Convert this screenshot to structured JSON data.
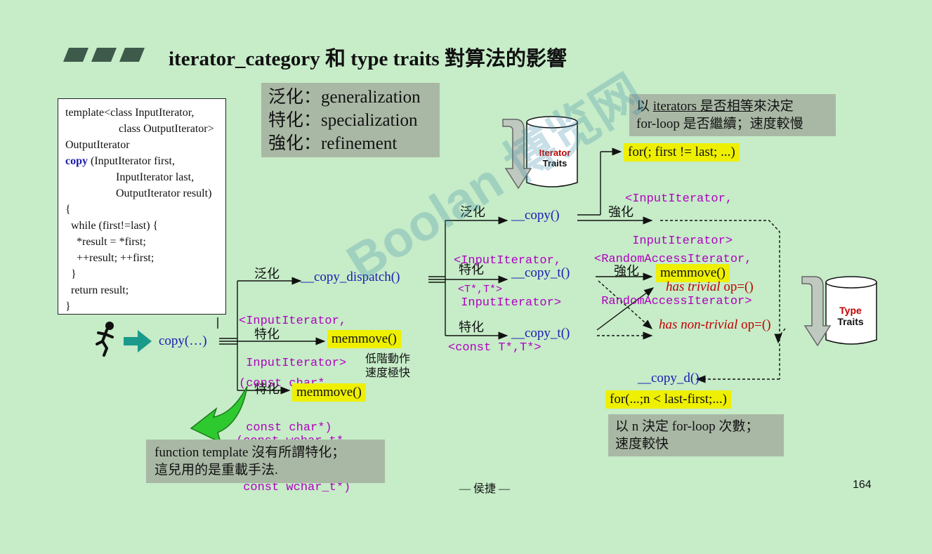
{
  "title": "iterator_category 和 type traits 對算法的影響",
  "legend": [
    "泛化：generalization",
    "特化：specialization",
    "強化：refinement"
  ],
  "code": [
    "template<class InputIterator,",
    "        class OutputIterator>",
    "OutputIterator",
    "copy",
    " (InputIterator first,",
    "        InputIterator last,",
    "        OutputIterator result)",
    "{",
    "  while (first!=last) {",
    "    *result = *first;",
    "    ++result; ++first;",
    "  }",
    "  return result;",
    "}"
  ],
  "labels": {
    "generalization": "泛化",
    "specialization": "特化",
    "refinement": "強化"
  },
  "nodes": {
    "copy_call": "copy(…)",
    "copy_dispatch": "__copy_dispatch()",
    "copy_dispatch_type1": "<InputIterator,",
    "copy_dispatch_type2": " InputIterator>",
    "memmove_char": "memmove()",
    "char_type1": "(const char*,",
    "char_type2": " const char*)",
    "low_level1": "低階動作",
    "low_level2": "速度極快",
    "memmove_wchar": "memmove()",
    "wchar_type1": "(const wchar_t*,",
    "wchar_type2": " const wchar_t*)",
    "copy_inner": "__copy()",
    "copy_inner_type1": "<InputIterator,",
    "copy_inner_type2": " InputIterator>",
    "copy_t1": "__copy_t()",
    "copy_t1_type": "<T*,T*>",
    "copy_t2": "__copy_t()",
    "copy_t2_type": "<const T*,T*>",
    "for_loop1": "for(; first != last; ...)",
    "for_loop1_type1": "<InputIterator,",
    "for_loop1_type2": " InputIterator>",
    "random_type1": "<RandomAccessIterator,",
    "random_type2": " RandomAccessIterator>",
    "memmove_trivial": "memmove()",
    "has_trivial": "has trivial",
    "op_eq1": " op=()",
    "has_non_trivial": "has non-trivial",
    "op_eq2": " op=()",
    "copy_d": "__copy_d()",
    "for_loop2": "for(...;n < last-first;...)"
  },
  "notes": {
    "iter_note1_pre": "以 ",
    "iter_note1_u": "iterators 是否相等",
    "iter_note1_post": "來決定",
    "iter_note2": "for-loop 是否繼續；速度較慢",
    "n_note1": "以 n 決定 for-loop 次數；",
    "n_note2": "速度較快",
    "func_note1": "function template 沒有所謂特化；",
    "func_note2": "這兒用的是重載手法."
  },
  "traits": {
    "iterator1": "Iterator",
    "iterator2": "Traits",
    "type1": "Type",
    "type2": "Traits"
  },
  "footer": {
    "author": "— 侯捷 —",
    "page": "164"
  },
  "watermark": "Boolan 博览网",
  "colors": {
    "background": "#c6ecc8",
    "highlight": "#eef000",
    "note_box": "#a9b8a5",
    "type_text": "#b000c0",
    "function_text": "#1a1ab0",
    "trait_text": "#c00000",
    "arrow_green": "#1a9a8a"
  }
}
